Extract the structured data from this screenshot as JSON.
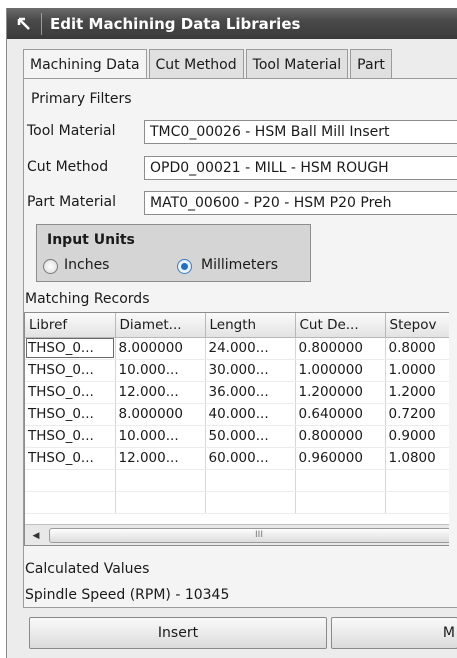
{
  "window": {
    "title": "Edit Machining Data Libraries"
  },
  "tabs": [
    {
      "label": "Machining Data"
    },
    {
      "label": "Cut Method"
    },
    {
      "label": "Tool Material"
    },
    {
      "label": "Part"
    }
  ],
  "filters": {
    "heading": "Primary Filters",
    "tool_material": {
      "label": "Tool Material",
      "value": "TMC0_00026 - HSM Ball Mill Insert"
    },
    "cut_method": {
      "label": "Cut Method",
      "value": "OPD0_00021 - MILL - HSM ROUGH"
    },
    "part_material": {
      "label": "Part Material",
      "value": "MAT0_00600 - P20 - HSM P20 Preh"
    }
  },
  "input_units": {
    "heading": "Input Units",
    "options": [
      "Inches",
      "Millimeters"
    ],
    "selected": "Millimeters"
  },
  "records": {
    "heading": "Matching Records",
    "columns": [
      "Libref",
      "Diamet...",
      "Length",
      "Cut De...",
      "Stepov"
    ],
    "rows": [
      [
        "THSO_0...",
        "8.000000",
        "24.000...",
        "0.800000",
        "0.8000"
      ],
      [
        "THSO_0...",
        "10.000...",
        "30.000...",
        "1.000000",
        "1.0000"
      ],
      [
        "THSO_0...",
        "12.000...",
        "36.000...",
        "1.200000",
        "1.2000"
      ],
      [
        "THSO_0...",
        "8.000000",
        "40.000...",
        "0.640000",
        "0.7200"
      ],
      [
        "THSO_0...",
        "10.000...",
        "50.000...",
        "0.800000",
        "0.9000"
      ],
      [
        "THSO_0...",
        "12.000...",
        "60.000...",
        "0.960000",
        "1.0800"
      ]
    ],
    "scroll_thumb_glyph": "III"
  },
  "calculated": {
    "heading": "Calculated Values",
    "spindle_speed": "Spindle Speed (RPM) - 10345"
  },
  "buttons": {
    "insert": "Insert",
    "second": "M"
  },
  "colors": {
    "titlebar": "#4a4a4a",
    "radio_accent": "#1f6fc4"
  }
}
